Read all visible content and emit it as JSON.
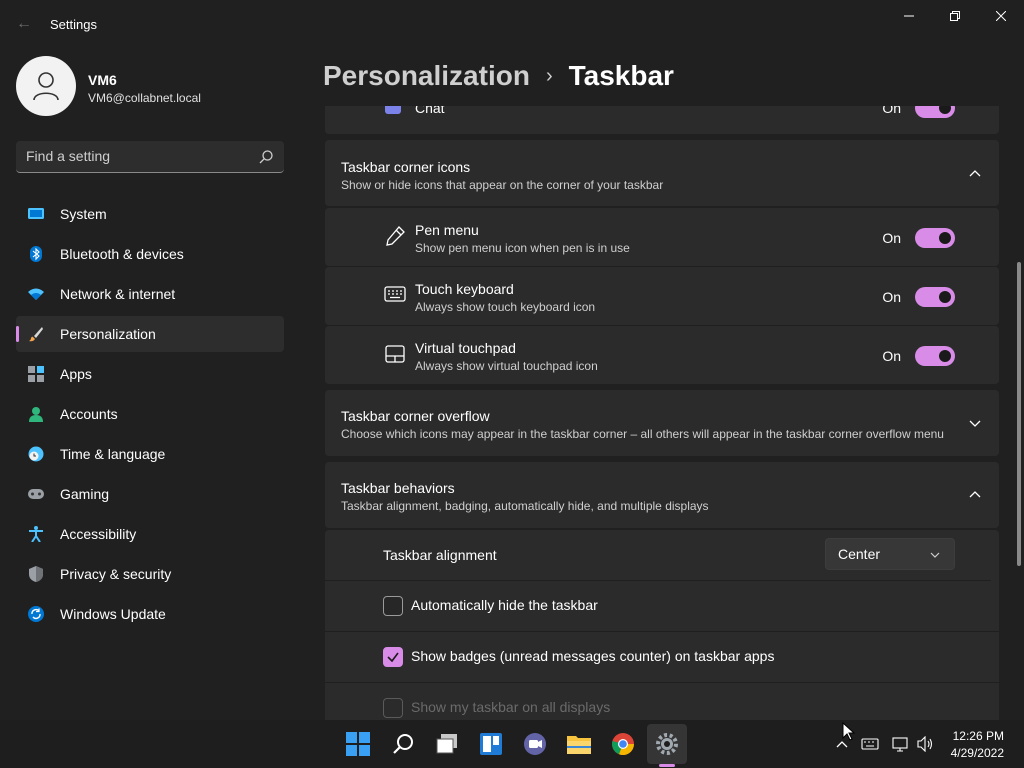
{
  "window": {
    "title": "Settings",
    "back_label": "←"
  },
  "profile": {
    "name": "VM6",
    "email": "VM6@collabnet.local"
  },
  "search": {
    "placeholder": "Find a setting"
  },
  "sidebar": {
    "items": [
      {
        "label": "System",
        "icon": "system-icon"
      },
      {
        "label": "Bluetooth & devices",
        "icon": "bluetooth-icon"
      },
      {
        "label": "Network & internet",
        "icon": "wifi-icon"
      },
      {
        "label": "Personalization",
        "icon": "brush-icon",
        "active": true
      },
      {
        "label": "Apps",
        "icon": "apps-icon"
      },
      {
        "label": "Accounts",
        "icon": "person-icon"
      },
      {
        "label": "Time & language",
        "icon": "clock-globe-icon"
      },
      {
        "label": "Gaming",
        "icon": "gamepad-icon"
      },
      {
        "label": "Accessibility",
        "icon": "accessibility-icon"
      },
      {
        "label": "Privacy & security",
        "icon": "shield-icon"
      },
      {
        "label": "Windows Update",
        "icon": "update-icon"
      }
    ]
  },
  "breadcrumb": {
    "parent": "Personalization",
    "separator": "›",
    "current": "Taskbar"
  },
  "chat_row": {
    "label": "Chat",
    "state": "On"
  },
  "corner_icons": {
    "title": "Taskbar corner icons",
    "desc": "Show or hide icons that appear on the corner of your taskbar",
    "rows": [
      {
        "title": "Pen menu",
        "desc": "Show pen menu icon when pen is in use",
        "state": "On"
      },
      {
        "title": "Touch keyboard",
        "desc": "Always show touch keyboard icon",
        "state": "On"
      },
      {
        "title": "Virtual touchpad",
        "desc": "Always show virtual touchpad icon",
        "state": "On"
      }
    ]
  },
  "corner_overflow": {
    "title": "Taskbar corner overflow",
    "desc": "Choose which icons may appear in the taskbar corner – all others will appear in the taskbar corner overflow menu"
  },
  "behaviors": {
    "title": "Taskbar behaviors",
    "desc": "Taskbar alignment, badging, automatically hide, and multiple displays",
    "alignment_label": "Taskbar alignment",
    "alignment_value": "Center",
    "auto_hide_label": "Automatically hide the taskbar",
    "auto_hide_checked": false,
    "badges_label": "Show badges (unread messages counter) on taskbar apps",
    "badges_checked": true,
    "all_displays_label": "Show my taskbar on all displays",
    "all_displays_enabled": false
  },
  "taskbar": {
    "apps": [
      "start-icon",
      "search-icon",
      "task-view-icon",
      "widgets-icon",
      "teams-chat-icon",
      "file-explorer-icon",
      "chrome-icon",
      "settings-icon"
    ],
    "active_app": "settings-icon",
    "time": "12:26 PM",
    "date": "4/29/2022"
  },
  "colors": {
    "accent": "#d98be8",
    "background": "#202020",
    "card": "#2b2b2b"
  }
}
